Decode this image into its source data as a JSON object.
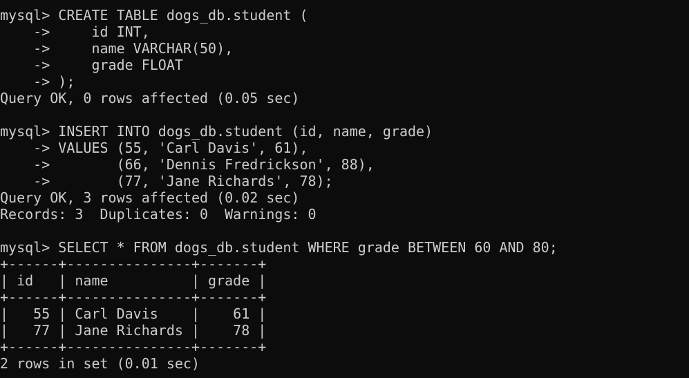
{
  "terminal": {
    "lines": [
      "mysql> CREATE TABLE dogs_db.student (",
      "    ->     id INT,",
      "    ->     name VARCHAR(50),",
      "    ->     grade FLOAT",
      "    -> );",
      "Query OK, 0 rows affected (0.05 sec)",
      "",
      "mysql> INSERT INTO dogs_db.student (id, name, grade)",
      "    -> VALUES (55, 'Carl Davis', 61),",
      "    ->        (66, 'Dennis Fredrickson', 88),",
      "    ->        (77, 'Jane Richards', 78);",
      "Query OK, 3 rows affected (0.02 sec)",
      "Records: 3  Duplicates: 0  Warnings: 0",
      "",
      "mysql> SELECT * FROM dogs_db.student WHERE grade BETWEEN 60 AND 80;",
      "+------+---------------+-------+",
      "| id   | name          | grade |",
      "+------+---------------+-------+",
      "|   55 | Carl Davis    |    61 |",
      "|   77 | Jane Richards |    78 |",
      "+------+---------------+-------+",
      "2 rows in set (0.01 sec)"
    ]
  }
}
